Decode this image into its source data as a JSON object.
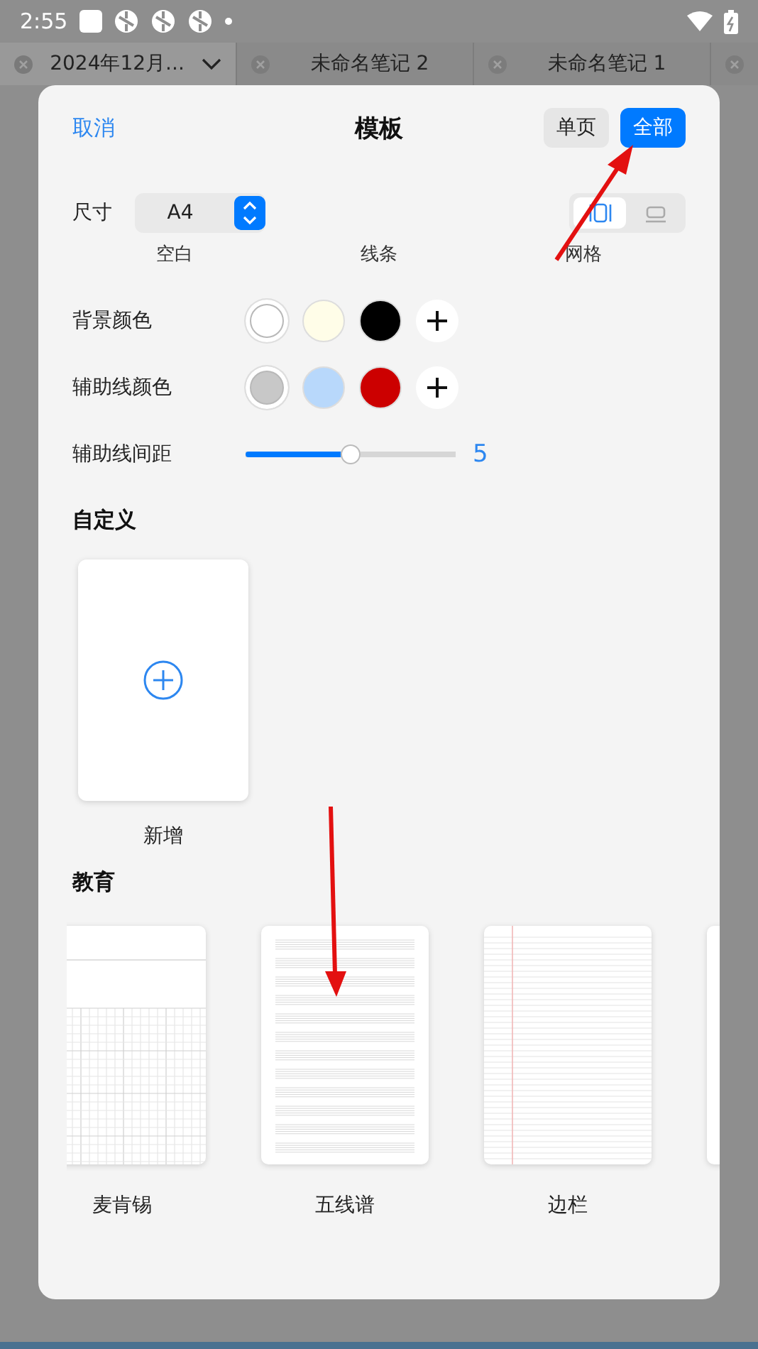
{
  "status_bar": {
    "time": "2:55"
  },
  "tabs": [
    {
      "label": "2024年12月...",
      "selected": true
    },
    {
      "label": "未命名笔记 2",
      "selected": false
    },
    {
      "label": "未命名笔记 1",
      "selected": false
    },
    {
      "selected": false
    }
  ],
  "dialog": {
    "cancel": "取消",
    "title": "模板",
    "scope": [
      {
        "label": "单页",
        "selected": false
      },
      {
        "label": "全部",
        "selected": true
      }
    ],
    "size": {
      "label": "尺寸",
      "value": "A4"
    },
    "orientation": [
      {
        "kind": "portrait",
        "selected": true
      },
      {
        "kind": "landscape",
        "selected": false
      }
    ],
    "styles": [
      "空白",
      "线条",
      "网格"
    ],
    "background_color": {
      "label": "背景颜色",
      "swatches": [
        {
          "color": "#ffffff",
          "selected": true
        },
        {
          "color": "#fffde8",
          "selected": false
        },
        {
          "color": "#000000",
          "selected": false
        }
      ]
    },
    "guide_color": {
      "label": "辅助线颜色",
      "swatches": [
        {
          "color": "#c8c8c8",
          "selected": true
        },
        {
          "color": "#b8d8fb",
          "selected": false
        },
        {
          "color": "#cc0000",
          "selected": false
        }
      ]
    },
    "guide_spacing": {
      "label": "辅助线间距",
      "level": 0.5,
      "reading": "5"
    },
    "custom": {
      "heading": "自定义",
      "new_label": "新增"
    },
    "education": {
      "heading": "教育",
      "templates": [
        {
          "kind": "cornell",
          "name": "麦肯锡"
        },
        {
          "kind": "staff",
          "name": "五线谱"
        },
        {
          "kind": "margin",
          "name": "边栏"
        },
        {
          "kind": "blank"
        }
      ]
    }
  }
}
